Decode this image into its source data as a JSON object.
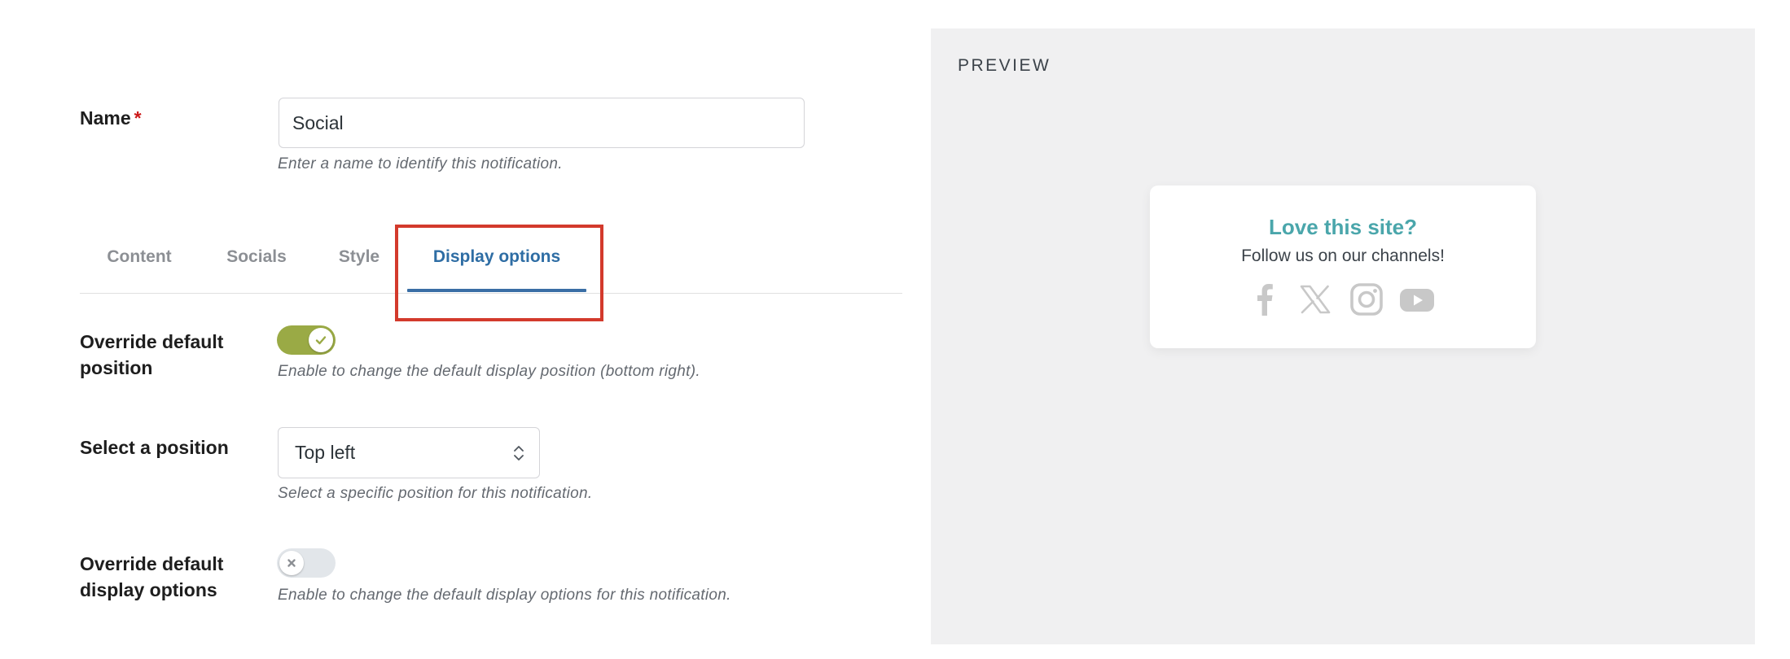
{
  "form": {
    "name": {
      "label": "Name",
      "required_mark": "*",
      "value": "Social",
      "help": "Enter a name to identify this notification."
    },
    "tabs": [
      {
        "label": "Content",
        "active": false
      },
      {
        "label": "Socials",
        "active": false
      },
      {
        "label": "Style",
        "active": false
      },
      {
        "label": "Display options",
        "active": true
      }
    ],
    "override_position": {
      "label_line1": "Override default",
      "label_line2": "position",
      "enabled": true,
      "help": "Enable to change the default display position (bottom right)."
    },
    "position_select": {
      "label": "Select a position",
      "value": "Top left",
      "help": "Select a specific position for this notification."
    },
    "override_display": {
      "label_line1": "Override default",
      "label_line2": "display options",
      "enabled": false,
      "help": "Enable to change the default display options for this notification."
    }
  },
  "preview": {
    "heading": "PREVIEW",
    "card": {
      "title": "Love this site?",
      "subtitle": "Follow us on our channels!",
      "icons": [
        "facebook-icon",
        "x-icon",
        "instagram-icon",
        "youtube-icon"
      ]
    }
  },
  "colors": {
    "toggle_on": "#9aaa45",
    "toggle_off": "#e2e6ea",
    "active_tab": "#2e6da4",
    "highlight_box": "#d33a2c",
    "preview_title": "#4aa6ab",
    "social_icon": "#c8c8c8",
    "required": "#cc1818"
  }
}
